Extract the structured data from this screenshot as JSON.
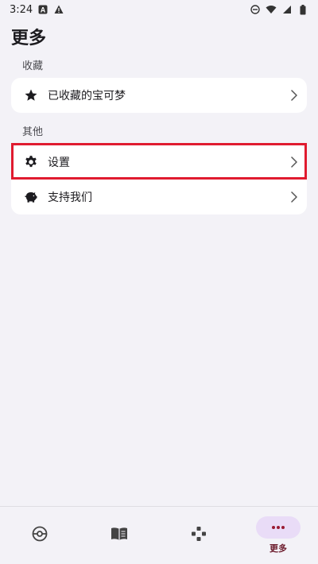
{
  "status_bar": {
    "time": "3:24",
    "left_icons": [
      "a-letter-icon",
      "warning-icon"
    ],
    "right_icons": [
      "do-not-disturb-icon",
      "wifi-icon",
      "signal-icon",
      "battery-icon"
    ]
  },
  "page": {
    "title": "更多"
  },
  "sections": [
    {
      "label": "收藏",
      "items": [
        {
          "label": "已收藏的宝可梦",
          "icon": "star-icon"
        }
      ]
    },
    {
      "label": "其他",
      "items": [
        {
          "label": "设置",
          "icon": "gear-icon"
        },
        {
          "label": "支持我们",
          "icon": "piggy-bank-icon"
        }
      ]
    }
  ],
  "bottom_nav": {
    "items": [
      {
        "icon": "pokeball-icon",
        "label": ""
      },
      {
        "icon": "book-icon",
        "label": ""
      },
      {
        "icon": "gamepad-icon",
        "label": ""
      },
      {
        "icon": "more-dots-icon",
        "label": "更多",
        "active": true
      }
    ]
  },
  "colors": {
    "background": "#f3f2f7",
    "card": "#ffffff",
    "highlight": "#e01b2f",
    "active_indicator": "#e9dcf7",
    "active_label": "#6b1a2b",
    "active_icon": "#9a1b33"
  }
}
